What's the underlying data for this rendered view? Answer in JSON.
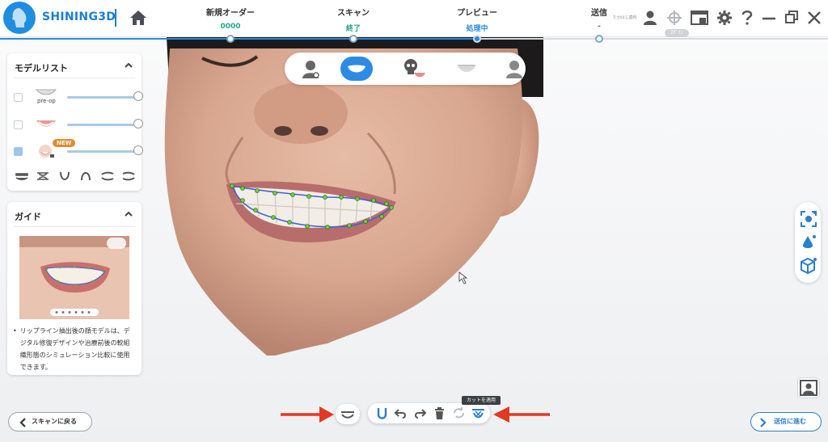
{
  "header": {
    "brand": "SHINING3D",
    "steps": [
      {
        "title": "新規オーダー",
        "status": "0000",
        "color": "#2aa58a"
      },
      {
        "title": "スキャン",
        "status": "終了",
        "color": "#2aa58a"
      },
      {
        "title": "プレビュー",
        "status": "処理中",
        "color": "#2a8ad9"
      },
      {
        "title": "送信",
        "status": "-",
        "color": "#666666"
      }
    ],
    "small_text": "たかはし歯科",
    "pill_text": "ﾛｸﾞｲﾝ"
  },
  "model_list": {
    "title": "モデルリスト",
    "items": [
      {
        "label": "pre-op",
        "checked": false,
        "opacity": 1.0
      },
      {
        "label": "",
        "checked": false,
        "opacity": 1.0
      },
      {
        "label": "",
        "checked": true,
        "opacity": 1.0,
        "badge": "NEW"
      }
    ],
    "view_icons": [
      "upper-jaw-icon",
      "bite-icon",
      "lower-arch-icon",
      "upper-arch-icon",
      "left-view-icon",
      "right-view-icon"
    ]
  },
  "guide": {
    "title": "ガイド",
    "text": "リップライン抽出後の顔モデルは、デジタル修復デザインや治療前後の軟組織形態のシミュレーション比較に使用できます。"
  },
  "tooltip": "カットを適用",
  "buttons": {
    "back": "スキャンに戻る",
    "next": "送信に進む"
  },
  "colors": {
    "accent": "#2e8be4",
    "brand": "#1a7fd4",
    "arrow": "#e03a22",
    "badge": "#e58a2a"
  }
}
